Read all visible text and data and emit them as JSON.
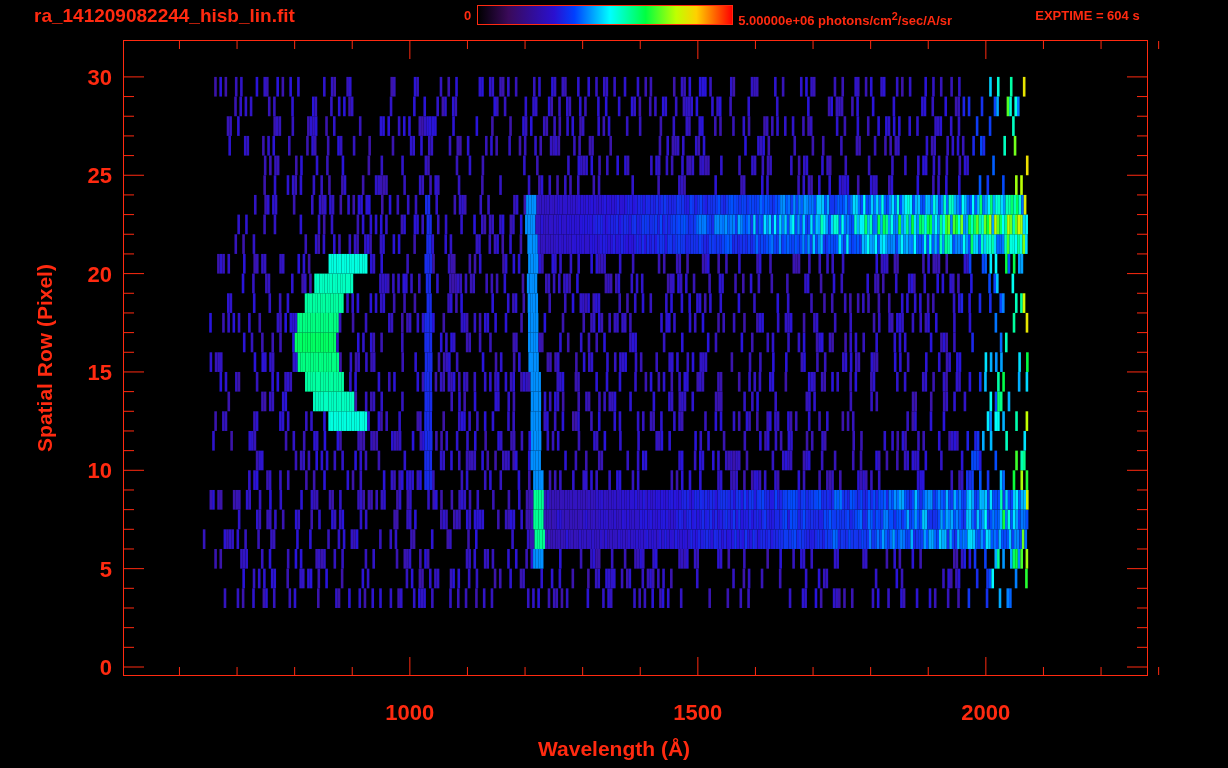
{
  "title": "ra_141209082244_hisb_lin.fit",
  "colorbar": {
    "min_label": "0",
    "max_label": "5.00000e+06 photons/cm$^{2}$/sec/A/sr"
  },
  "exposure": "EXPTIME = 604 s",
  "plot": {
    "ylabel": "Spatial Row (Pixel)",
    "xlabel": "Wavelength (Å)",
    "yticks": [
      "30",
      "25",
      "20",
      "15",
      "10",
      "5",
      "0"
    ],
    "xticks": [
      "1000",
      "1500",
      "2000"
    ]
  }
}
